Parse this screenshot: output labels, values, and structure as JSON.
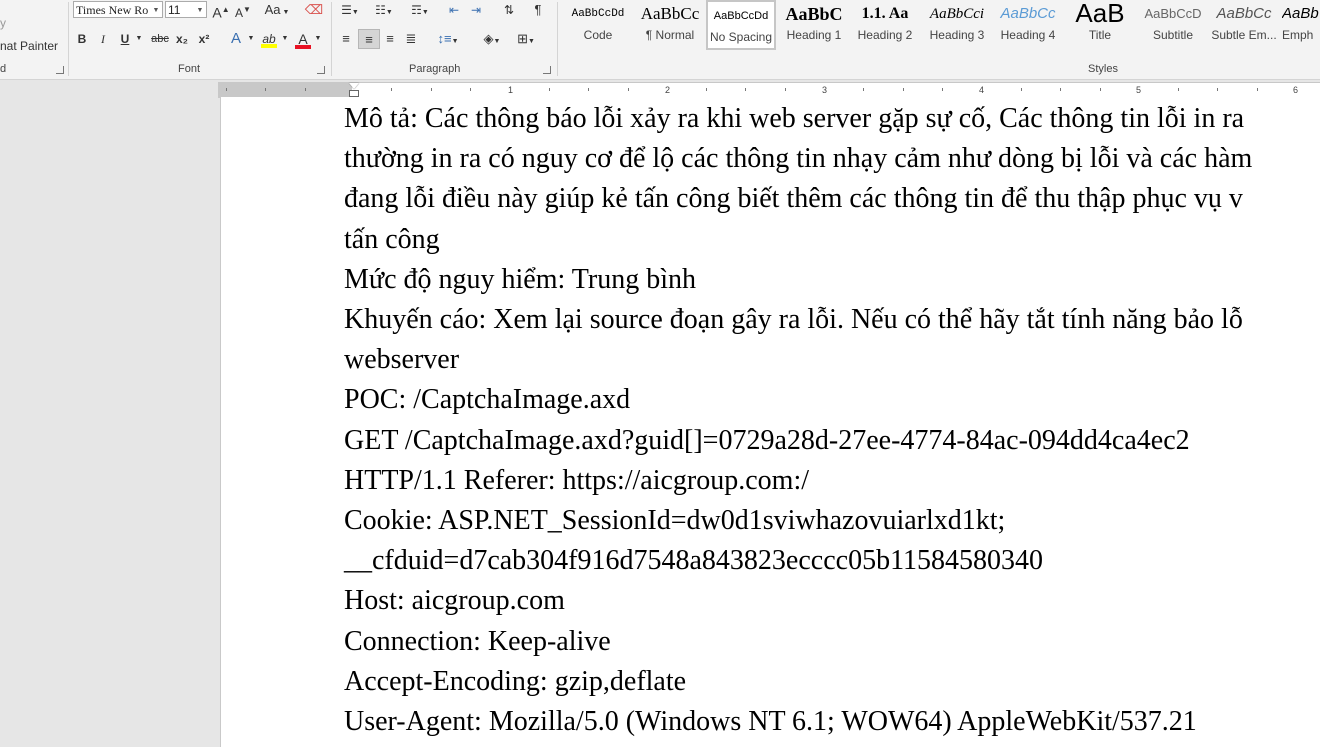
{
  "clipboard": {
    "copy_partial": "y",
    "format_painter": "nat Painter",
    "label_partial": "d"
  },
  "font": {
    "name_value": "Times New Ro",
    "size_value": "11",
    "grow_glyph": "A",
    "shrink_glyph": "A",
    "case_glyph": "Aa",
    "bold": "B",
    "italic": "I",
    "underline": "U",
    "strike": "abc",
    "subscript": "x₂",
    "superscript": "x²",
    "effects_glyph": "A",
    "highlight_glyph": "ab",
    "color_glyph": "A",
    "label": "Font"
  },
  "paragraph": {
    "label": "Paragraph",
    "show_marks_glyph": "¶"
  },
  "styles": {
    "label": "Styles",
    "items": [
      {
        "preview": "AaBbCcDd",
        "name": "Code"
      },
      {
        "preview": "AaBbCc",
        "name": "¶ Normal"
      },
      {
        "preview": "AaBbCcDd",
        "name": "No Spacing"
      },
      {
        "preview": "AaBbC",
        "name": "Heading 1"
      },
      {
        "preview": "1.1. Aa",
        "name": "Heading 2"
      },
      {
        "preview": "AaBbCci",
        "name": "Heading 3"
      },
      {
        "preview": "AaBbCc",
        "name": "Heading 4"
      },
      {
        "preview": "AaB",
        "name": "Title"
      },
      {
        "preview": "AaBbCcD",
        "name": "Subtitle"
      },
      {
        "preview": "AaBbCc",
        "name": "Subtle Em..."
      },
      {
        "preview": "AaBb",
        "name": "Emph"
      }
    ]
  },
  "ruler": {
    "numbers": [
      "1",
      "2",
      "3",
      "4",
      "5",
      "6"
    ]
  },
  "colors": {
    "font_color_bar": "#e81123",
    "highlight_bar": "#ffff00",
    "heading4_blue": "#5b9bd5"
  },
  "document": {
    "lines": [
      "Mô tả: Các thông báo lỗi xảy ra khi web server gặp sự cố, Các thông tin lỗi in ra",
      "thường in ra có nguy cơ để lộ các thông tin nhạy cảm như dòng bị lỗi và các hàm",
      "đang lỗi điều này giúp kẻ tấn công biết thêm các thông tin để thu thập phục vụ v",
      "tấn công",
      "Mức độ nguy hiểm: Trung bình",
      "Khuyến cáo: Xem lại source đoạn gây ra lỗi. Nếu có thể hãy tắt tính năng bảo lỗ",
      "webserver",
      "POC: /CaptchaImage.axd",
      "GET /CaptchaImage.axd?guid[]=0729a28d-27ee-4774-84ac-094dd4ca4ec2",
      "HTTP/1.1 Referer: https://aicgroup.com:/",
      "Cookie: ASP.NET_SessionId=dw0d1sviwhazovuiarlxd1kt;",
      "__cfduid=d7cab304f916d7548a843823ecccc05b11584580340",
      "Host: aicgroup.com",
      "Connection: Keep-alive",
      "Accept-Encoding: gzip,deflate",
      "User-Agent: Mozilla/5.0 (Windows NT 6.1; WOW64) AppleWebKit/537.21"
    ]
  }
}
